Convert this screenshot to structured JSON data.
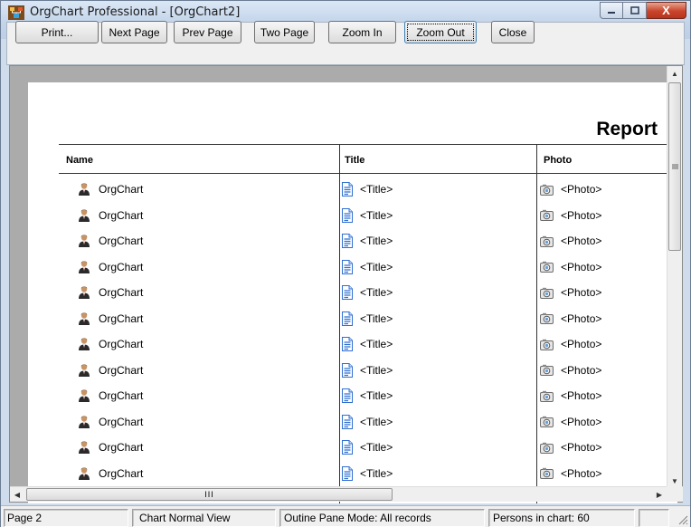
{
  "window": {
    "title": "OrgChart Professional - [OrgChart2]",
    "caption": {
      "minimize_icon": "minimize-icon",
      "maximize_icon": "maximize-icon",
      "close_icon": "close-icon",
      "close_glyph": "X"
    }
  },
  "toolbar": {
    "buttons": [
      {
        "label": "Print...",
        "name": "print-button"
      },
      {
        "label": "Next Page",
        "name": "next-page-button"
      },
      {
        "label": "Prev Page",
        "name": "prev-page-button"
      },
      {
        "label": "Two Page",
        "name": "two-page-button"
      },
      {
        "label": "Zoom In",
        "name": "zoom-in-button"
      },
      {
        "label": "Zoom Out",
        "name": "zoom-out-button"
      },
      {
        "label": "Close",
        "name": "close-button"
      }
    ]
  },
  "report": {
    "title": "Report",
    "columns": {
      "name": "Name",
      "title": "Title",
      "photo": "Photo"
    },
    "rows": [
      {
        "name": "OrgChart",
        "title": "<Title>",
        "photo": "<Photo>"
      },
      {
        "name": "OrgChart",
        "title": "<Title>",
        "photo": "<Photo>"
      },
      {
        "name": "OrgChart",
        "title": "<Title>",
        "photo": "<Photo>"
      },
      {
        "name": "OrgChart",
        "title": "<Title>",
        "photo": "<Photo>"
      },
      {
        "name": "OrgChart",
        "title": "<Title>",
        "photo": "<Photo>"
      },
      {
        "name": "OrgChart",
        "title": "<Title>",
        "photo": "<Photo>"
      },
      {
        "name": "OrgChart",
        "title": "<Title>",
        "photo": "<Photo>"
      },
      {
        "name": "OrgChart",
        "title": "<Title>",
        "photo": "<Photo>"
      },
      {
        "name": "OrgChart",
        "title": "<Title>",
        "photo": "<Photo>"
      },
      {
        "name": "OrgChart",
        "title": "<Title>",
        "photo": "<Photo>"
      },
      {
        "name": "OrgChart",
        "title": "<Title>",
        "photo": "<Photo>"
      },
      {
        "name": "OrgChart",
        "title": "<Title>",
        "photo": "<Photo>"
      }
    ],
    "icons": {
      "person": "person-icon",
      "title": "document-icon",
      "photo": "camera-icon"
    }
  },
  "scrollbars": {
    "h_thumb_grip": "III"
  },
  "status": {
    "page": "Page 2",
    "view": "Chart Normal View",
    "mode": "Outine Pane Mode: All records",
    "persons": "Persons in chart: 60",
    "extra": ""
  },
  "colors": {
    "titlebar": "#c3d4ea",
    "close_button": "#c8442a",
    "preview_bg": "#ababab",
    "doc_icon": "#2f6fd1"
  }
}
